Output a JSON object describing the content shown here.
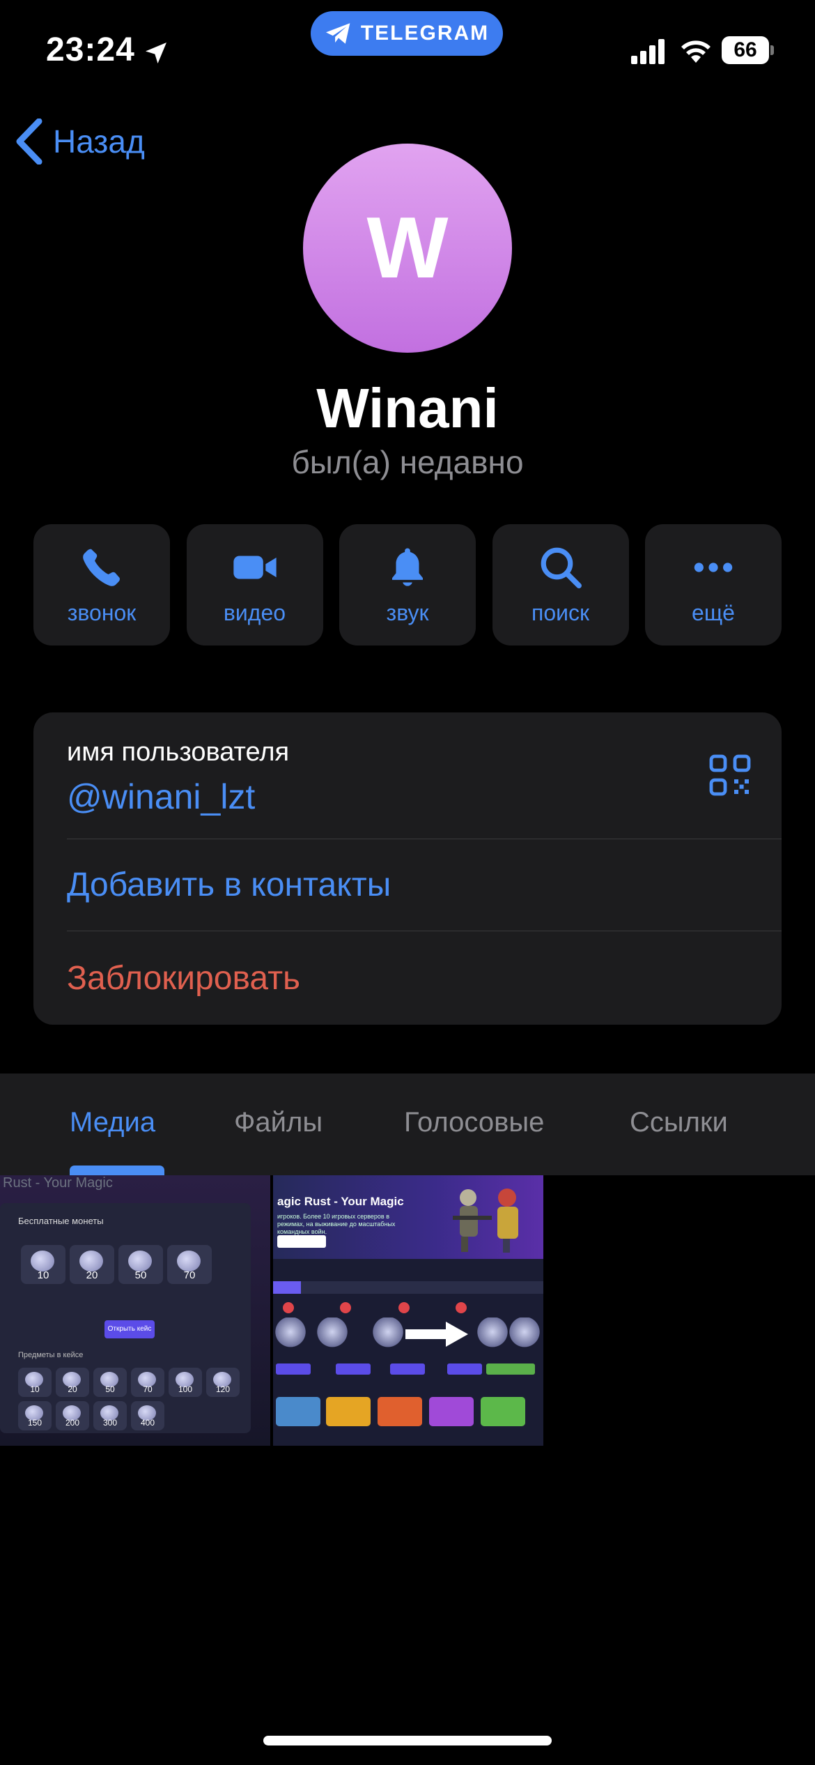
{
  "status_bar": {
    "time": "23:24",
    "app_pill": "TELEGRAM",
    "battery": "66",
    "icons": [
      "location-arrow-icon",
      "signal-icon",
      "wifi-icon",
      "battery-icon"
    ]
  },
  "nav": {
    "back_label": "Назад"
  },
  "profile": {
    "avatar_letter": "W",
    "name": "Winani",
    "status": "был(а) недавно"
  },
  "actions": [
    {
      "label": "звонок",
      "icon": "phone-icon"
    },
    {
      "label": "видео",
      "icon": "video-camera-icon"
    },
    {
      "label": "звук",
      "icon": "bell-icon"
    },
    {
      "label": "поиск",
      "icon": "search-icon"
    },
    {
      "label": "ещё",
      "icon": "more-dots-icon"
    }
  ],
  "info": {
    "username_caption": "имя пользователя",
    "username": "@winani_lzt",
    "add_contact": "Добавить в контакты",
    "block": "Заблокировать"
  },
  "tabs": [
    {
      "label": "Медиа",
      "active": true
    },
    {
      "label": "Файлы",
      "active": false
    },
    {
      "label": "Голосовые",
      "active": false
    },
    {
      "label": "Ссылки",
      "active": false
    }
  ],
  "media": {
    "thumb1": {
      "heading": "Rust - Your Magic",
      "panel_title": "Бесплатные монеты",
      "coins_top": [
        "10",
        "20",
        "50",
        "70"
      ],
      "coins_bottom": [
        "10",
        "20",
        "50",
        "70",
        "100",
        "120",
        "150",
        "200",
        "300",
        "400"
      ],
      "button": "Открыть кейс",
      "subheading": "Предметы в кейсе"
    },
    "thumb2": {
      "title": "agic Rust - Your Magic",
      "desc": "игроков. Более 10 игровых серверов в режимах, на выживание до масштабных командных войн."
    }
  },
  "colors": {
    "accent": "#4a8ef5",
    "danger": "#e0604f",
    "card_bg": "#1c1c1e",
    "secondary_text": "#8e8e93"
  }
}
